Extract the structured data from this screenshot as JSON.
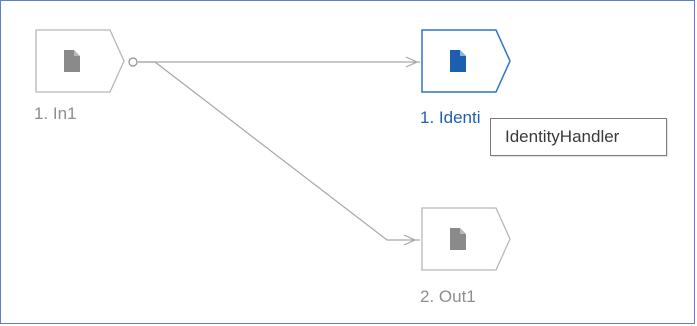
{
  "diagram": {
    "nodes": [
      {
        "id": "in1",
        "label": "1. In1",
        "type": "inport",
        "selected": false
      },
      {
        "id": "identity",
        "label": "1. Identi",
        "type": "block",
        "selected": true
      },
      {
        "id": "out1",
        "label": "2. Out1",
        "type": "outport",
        "selected": false
      }
    ],
    "tooltip": {
      "text": "IdentityHandler"
    },
    "colors": {
      "frame": "#5b7fcf",
      "node_border": "#b7b7b7",
      "node_icon": "#8a8a8a",
      "selected_border": "#2b74c7",
      "selected_icon": "#1c5fb0",
      "wire": "#a6a6a6"
    }
  }
}
